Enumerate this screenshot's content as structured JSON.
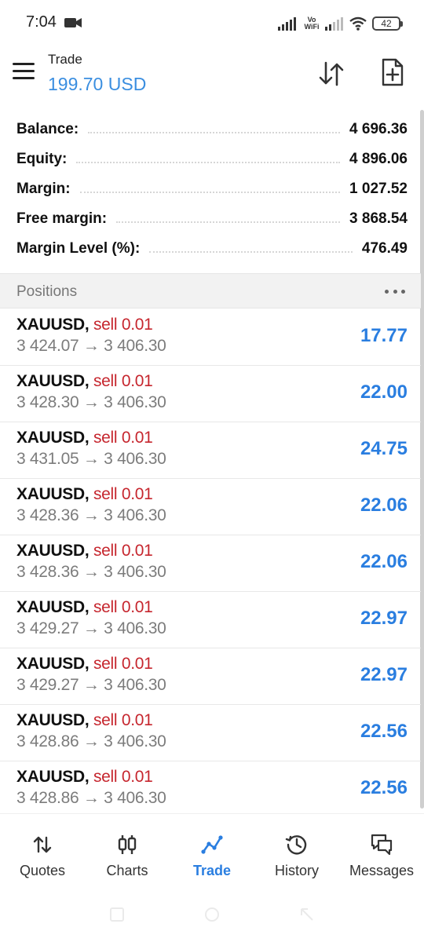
{
  "status_bar": {
    "time": "7:04",
    "network_label": "Vo WiFi",
    "battery": "42",
    "icons": [
      "video-camera-icon",
      "signal-icon",
      "signal-weak-icon",
      "wifi-icon",
      "battery-icon"
    ]
  },
  "header": {
    "title": "Trade",
    "subtitle": "199.70 USD",
    "accent_color": "#3a8ee0",
    "icons": [
      "menu-icon",
      "sort-icon",
      "new-order-icon"
    ]
  },
  "account": [
    {
      "label": "Balance:",
      "value": "4 696.36"
    },
    {
      "label": "Equity:",
      "value": "4 896.06"
    },
    {
      "label": "Margin:",
      "value": "1 027.52"
    },
    {
      "label": "Free margin:",
      "value": "3 868.54"
    },
    {
      "label": "Margin Level (%):",
      "value": "476.49"
    }
  ],
  "positions": {
    "title": "Positions",
    "sell_color": "#c6262e",
    "profit_color": "#2a7ee0",
    "items": [
      {
        "symbol": "XAUUSD,",
        "type": "sell 0.01",
        "open": "3 424.07",
        "arrow": "→",
        "current": "3 406.30",
        "profit": "17.77"
      },
      {
        "symbol": "XAUUSD,",
        "type": "sell 0.01",
        "open": "3 428.30",
        "arrow": "→",
        "current": "3 406.30",
        "profit": "22.00"
      },
      {
        "symbol": "XAUUSD,",
        "type": "sell 0.01",
        "open": "3 431.05",
        "arrow": "→",
        "current": "3 406.30",
        "profit": "24.75"
      },
      {
        "symbol": "XAUUSD,",
        "type": "sell 0.01",
        "open": "3 428.36",
        "arrow": "→",
        "current": "3 406.30",
        "profit": "22.06"
      },
      {
        "symbol": "XAUUSD,",
        "type": "sell 0.01",
        "open": "3 428.36",
        "arrow": "→",
        "current": "3 406.30",
        "profit": "22.06"
      },
      {
        "symbol": "XAUUSD,",
        "type": "sell 0.01",
        "open": "3 429.27",
        "arrow": "→",
        "current": "3 406.30",
        "profit": "22.97"
      },
      {
        "symbol": "XAUUSD,",
        "type": "sell 0.01",
        "open": "3 429.27",
        "arrow": "→",
        "current": "3 406.30",
        "profit": "22.97"
      },
      {
        "symbol": "XAUUSD,",
        "type": "sell 0.01",
        "open": "3 428.86",
        "arrow": "→",
        "current": "3 406.30",
        "profit": "22.56"
      },
      {
        "symbol": "XAUUSD,",
        "type": "sell 0.01",
        "open": "3 428.86",
        "arrow": "→",
        "current": "3 406.30",
        "profit": "22.56"
      }
    ]
  },
  "nav": {
    "active": "Trade",
    "items": [
      {
        "label": "Quotes",
        "icon": "quotes-icon"
      },
      {
        "label": "Charts",
        "icon": "charts-icon"
      },
      {
        "label": "Trade",
        "icon": "trade-icon"
      },
      {
        "label": "History",
        "icon": "history-icon"
      },
      {
        "label": "Messages",
        "icon": "messages-icon"
      }
    ]
  }
}
